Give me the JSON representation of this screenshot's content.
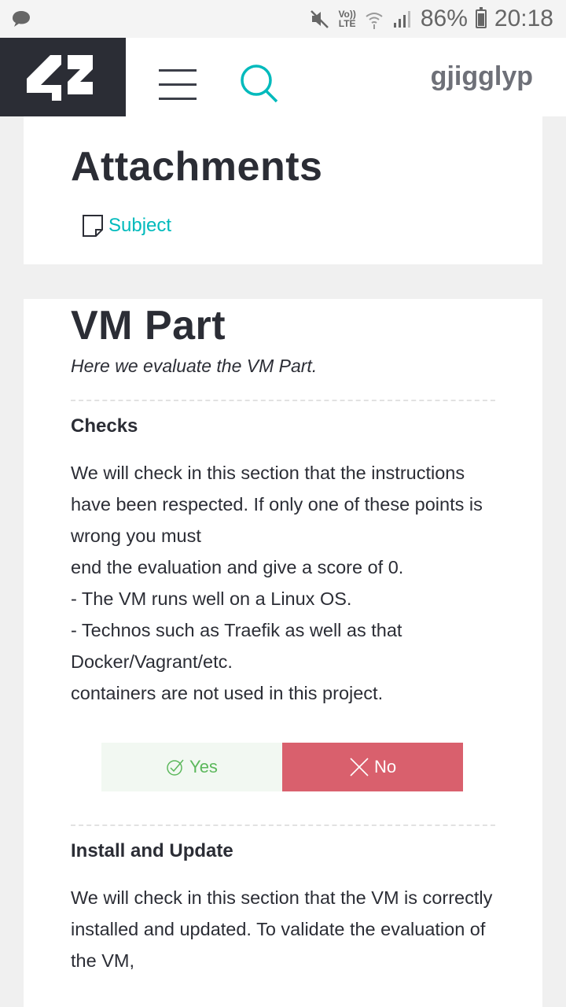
{
  "status_bar": {
    "battery": "86%",
    "time": "20:18",
    "network": "LTE"
  },
  "header": {
    "logo_text": "42",
    "username": "gjigglyp"
  },
  "attachments": {
    "title": "Attachments",
    "items": [
      {
        "label": "Subject"
      }
    ]
  },
  "vm_part": {
    "title": "VM Part",
    "subtitle": "Here we evaluate the VM Part.",
    "sections": [
      {
        "title": "Checks",
        "body": "We will check in this section that the instructions have been respected. If only one of these points is wrong you must\nend the evaluation and give a score of 0.\n- The VM runs well on a Linux OS.\n- Technos such as Traefik as well as that Docker/Vagrant/etc.\ncontainers are not used in this project.",
        "yes_label": "Yes",
        "no_label": "No"
      },
      {
        "title": "Install and Update",
        "body": "We will check in this section that the VM is correctly\ninstalled and updated. To validate the evaluation of the VM,"
      }
    ]
  },
  "colors": {
    "dark": "#2b2d35",
    "accent": "#00babc",
    "yes_green": "#5cb85c",
    "no_red": "#d9606d"
  }
}
